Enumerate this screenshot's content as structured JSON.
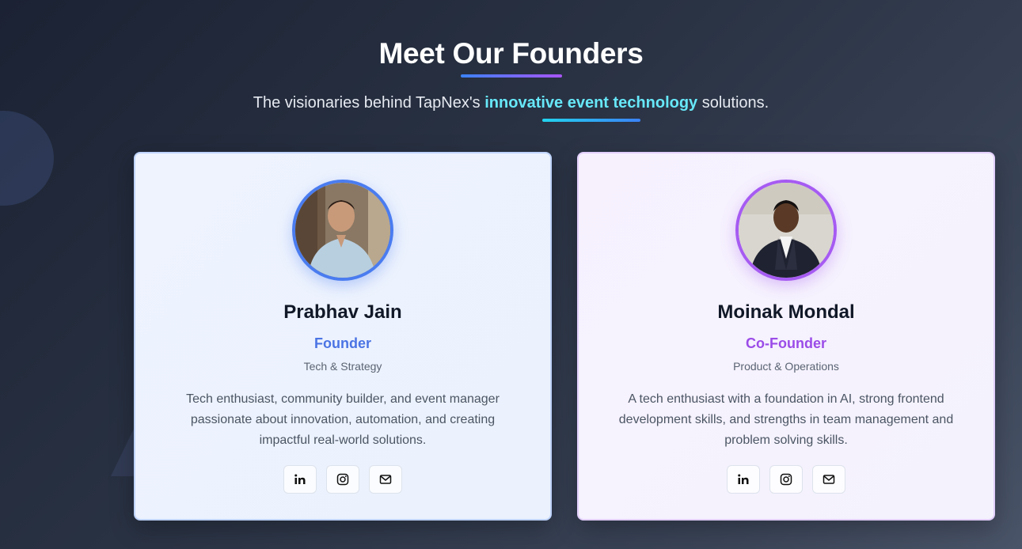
{
  "header": {
    "title": "Meet Our Founders",
    "subtitle_before": "The visionaries behind TapNex's ",
    "subtitle_highlight": "innovative event technology",
    "subtitle_after": " solutions."
  },
  "founders": [
    {
      "name": "Prabhav Jain",
      "role": "Founder",
      "focus": "Tech & Strategy",
      "bio": "Tech enthusiast, community builder, and event manager passionate about innovation, automation, and creating impactful real-world solutions.",
      "accent": "#4a7cf0",
      "socials": [
        "linkedin-icon",
        "instagram-icon",
        "mail-icon"
      ]
    },
    {
      "name": "Moinak Mondal",
      "role": "Co-Founder",
      "focus": "Product & Operations",
      "bio": "A tech enthusiast with a foundation in AI, strong frontend development skills, and strengths in team management and problem solving skills.",
      "accent": "#a65bf2",
      "socials": [
        "linkedin-icon",
        "instagram-icon",
        "mail-icon"
      ]
    }
  ],
  "colors": {
    "highlight": "#67e8f9",
    "founder_role": "#4b74e4",
    "cofounder_role": "#9b4ce8"
  }
}
